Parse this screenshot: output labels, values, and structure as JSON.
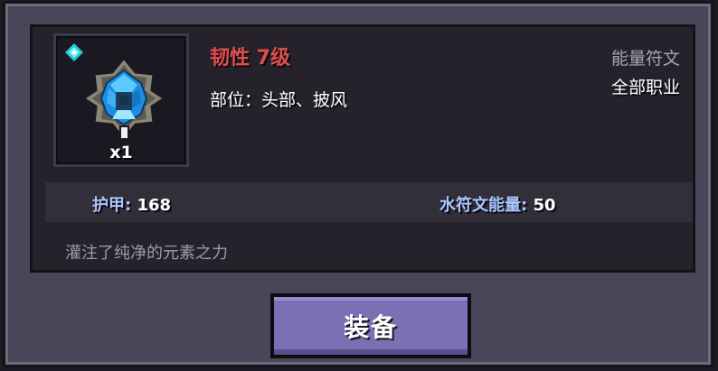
{
  "item": {
    "name": "韧性 7级",
    "slot": "部位：头部、披风",
    "type": "能量符文",
    "class": "全部职业",
    "quantity": "x1",
    "icon": "blue-rune-gem-icon"
  },
  "stats": {
    "armor_label": "护甲:",
    "armor_value": "168",
    "energy_label": "水符文能量:",
    "energy_value": "50"
  },
  "description": "灌注了纯净的元素之力",
  "actions": {
    "equip_label": "装备"
  },
  "colors": {
    "name": "#e14d4d",
    "stat_label": "#a9c6ff",
    "button": "#7d6fb4",
    "panel": "#4a4558"
  }
}
